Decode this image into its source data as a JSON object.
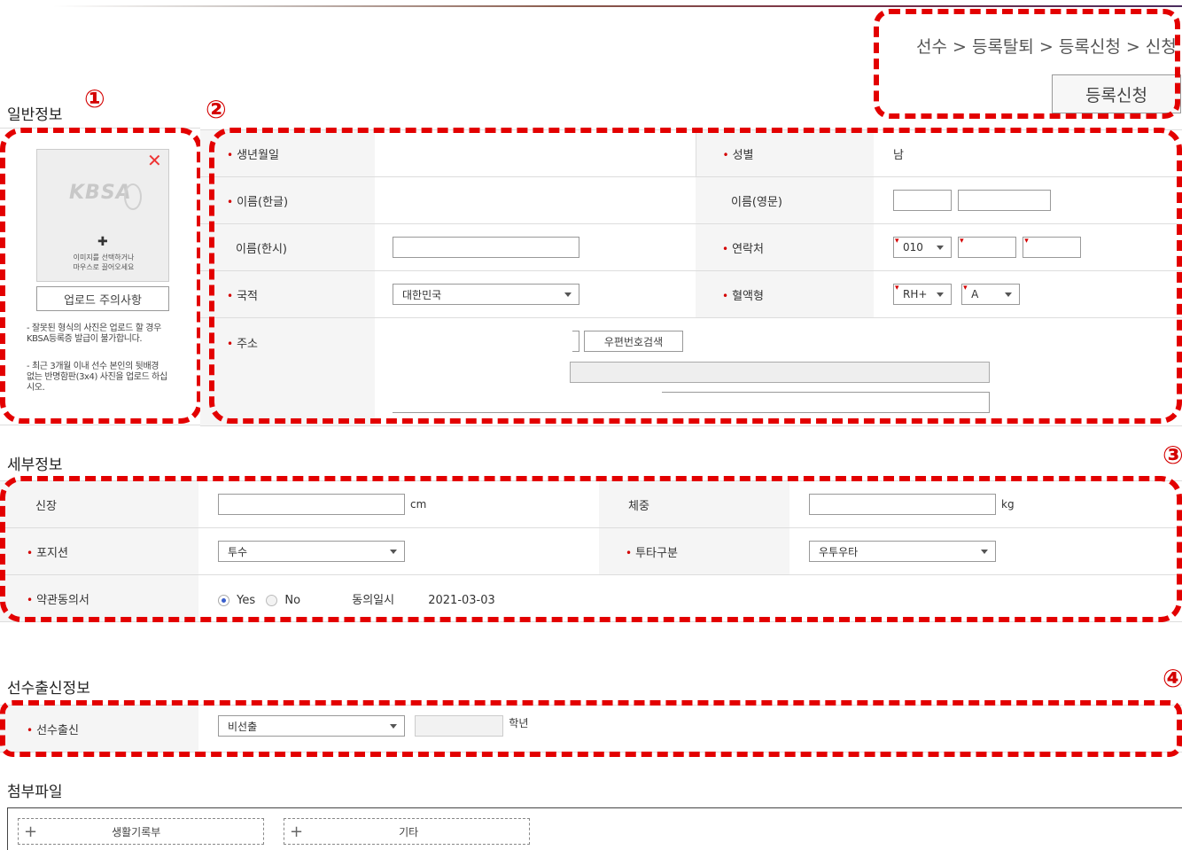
{
  "breadcrumb": "선수 > 등록탈퇴 > 등록신청 > 신청",
  "register_button": "등록신청",
  "markers": {
    "m1": "①",
    "m2": "②",
    "m3": "③",
    "m4": "④"
  },
  "general": {
    "title": "일반정보",
    "photo": {
      "logo": "KBSA",
      "close": "✕",
      "plus": "✚",
      "hint": "이미지를 선택하거나\n마우스로 끌어오세요",
      "upload_button": "업로드 주의사항",
      "note1": "- 잘못된 형식의 사진은 업로드 할 경우 KBSA등록증 발급이 불가합니다.",
      "note2": "- 최근 3개월 이내 선수 본인의 뒷배경 없는 반명함판(3x4) 사진을 업로드 하십시오."
    },
    "fields": {
      "birth_label": "생년월일",
      "gender_label": "성별",
      "gender_value": "남",
      "name_kr_label": "이름(한글)",
      "name_en_label": "이름(영문)",
      "name_cn_label": "이름(한시)",
      "phone_label": "연락처",
      "phone_prefix": "010",
      "nationality_label": "국적",
      "nationality_value": "대한민국",
      "blood_label": "혈액형",
      "blood_rh": "RH+",
      "blood_abo": "A",
      "address_label": "주소",
      "zip_button": "우편번호검색"
    }
  },
  "detail": {
    "title": "세부정보",
    "height_label": "신장",
    "height_unit": "cm",
    "weight_label": "체중",
    "weight_unit": "kg",
    "position_label": "포지션",
    "position_value": "투수",
    "bat_label": "투타구분",
    "bat_value": "우투우타",
    "terms_label": "약관동의서",
    "yes": "Yes",
    "no": "No",
    "agree_date_label": "동의일시",
    "agree_date": "2021-03-03"
  },
  "origin": {
    "title": "선수출신정보",
    "label": "선수출신",
    "value": "비선출",
    "grade_unit": "학년"
  },
  "attachments": {
    "title": "첨부파일",
    "items": [
      "생활기록부",
      "기타"
    ]
  },
  "colors": {
    "accent_red": "#e30000",
    "radio_blue": "#3a5fcd"
  }
}
